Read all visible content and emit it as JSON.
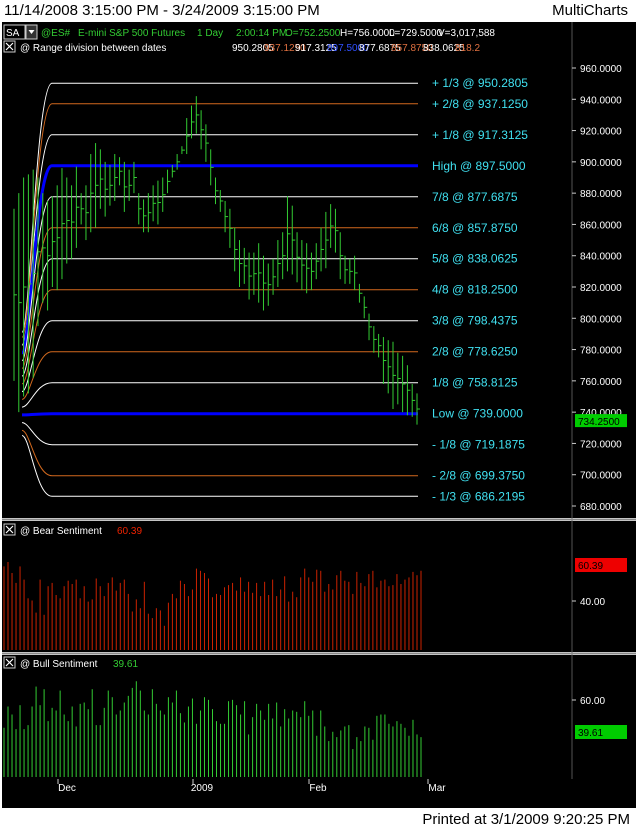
{
  "window": {
    "date_range": "11/14/2008 3:15:00 PM - 3/24/2009 3:15:00 PM",
    "app_name": "MultiCharts",
    "printed": "Printed at 3/1/2009 9:20:25 PM"
  },
  "colors": {
    "background": "#000000",
    "price_bar": "#33cc33",
    "white_level": "#ffffff",
    "orange_level": "#d2691e",
    "blue_level": "#0000ff",
    "level_label": "#40e0f0",
    "bear": "#cc2200",
    "bull": "#33cc33",
    "last_price_bg": "#00cc00",
    "bear_value_bg": "#ee0000"
  },
  "header": {
    "sa_button": "SA",
    "symbol": "@ES#",
    "description": "E-mini S&P 500 Futures",
    "interval": "1 Day",
    "time": "2:00:14 PM",
    "open": "O=752.2500",
    "high": "H=756.0000",
    "low": "L=729.5000",
    "volume": "V=3,017,588"
  },
  "study_header": {
    "name": "@ Range division between dates",
    "values": [
      {
        "text": "950.2805",
        "color": "#ffffff"
      },
      {
        "text": "937.1250",
        "color": "#e07040"
      },
      {
        "text": "917.3125",
        "color": "#ffffff"
      },
      {
        "text": "897.5000",
        "color": "#3050ff"
      },
      {
        "text": "877.6875",
        "color": "#ffffff"
      },
      {
        "text": "857.8750",
        "color": "#e07040"
      },
      {
        "text": "838.0625",
        "color": "#ffffff"
      },
      {
        "text": "818.2",
        "color": "#e07040"
      }
    ]
  },
  "bear_panel": {
    "name": "@ Bear Sentiment",
    "value": "60.39",
    "tick": "40.00"
  },
  "bull_panel": {
    "name": "@ Bull Sentiment",
    "value": "39.61",
    "tick": "60.00"
  },
  "chart_data": [
    {
      "type": "ohlc",
      "title": "@ES# E-mini S&P 500 Futures 1 Day",
      "x_labels": [
        "Dec",
        "2009",
        "Feb",
        "Mar"
      ],
      "ylim": [
        672,
        966
      ],
      "y_ticks": [
        "960.0000",
        "940.0000",
        "920.0000",
        "900.0000",
        "880.0000",
        "860.0000",
        "840.0000",
        "820.0000",
        "800.0000",
        "780.0000",
        "760.0000",
        "740.0000",
        "720.0000",
        "700.0000",
        "680.0000"
      ],
      "last_price": "734.2500",
      "levels": [
        {
          "label": "+ 1/3 @ 950.2805",
          "value": 950.2805,
          "color": "white"
        },
        {
          "label": "+ 2/8 @ 937.1250",
          "value": 937.125,
          "color": "orange"
        },
        {
          "label": "+ 1/8 @ 917.3125",
          "value": 917.3125,
          "color": "white"
        },
        {
          "label": "High @ 897.5000",
          "value": 897.5,
          "color": "blue"
        },
        {
          "label": "7/8 @ 877.6875",
          "value": 877.6875,
          "color": "white"
        },
        {
          "label": "6/8 @ 857.8750",
          "value": 857.875,
          "color": "orange"
        },
        {
          "label": "5/8 @ 838.0625",
          "value": 838.0625,
          "color": "white"
        },
        {
          "label": "4/8 @ 818.2500",
          "value": 818.25,
          "color": "orange"
        },
        {
          "label": "3/8 @ 798.4375",
          "value": 798.4375,
          "color": "white"
        },
        {
          "label": "2/8 @ 778.6250",
          "value": 778.625,
          "color": "orange"
        },
        {
          "label": "1/8 @ 758.8125",
          "value": 758.8125,
          "color": "white"
        },
        {
          "label": "Low @ 739.0000",
          "value": 739.0,
          "color": "blue"
        },
        {
          "label": "- 1/8 @ 719.1875",
          "value": 719.1875,
          "color": "white"
        },
        {
          "label": "- 2/8 @ 699.3750",
          "value": 699.375,
          "color": "orange"
        },
        {
          "label": "- 1/3 @ 686.2195",
          "value": 686.2195,
          "color": "white"
        }
      ],
      "bars": [
        [
          870,
          760
        ],
        [
          880,
          740
        ],
        [
          890,
          750
        ],
        [
          892,
          752
        ],
        [
          895,
          762
        ],
        [
          890,
          795
        ],
        [
          880,
          810
        ],
        [
          875,
          805
        ],
        [
          878,
          820
        ],
        [
          885,
          818
        ],
        [
          896,
          825
        ],
        [
          890,
          835
        ],
        [
          885,
          838
        ],
        [
          897,
          845
        ],
        [
          880,
          860
        ],
        [
          885,
          850
        ],
        [
          905,
          855
        ],
        [
          912,
          858
        ],
        [
          908,
          870
        ],
        [
          900,
          865
        ],
        [
          898,
          872
        ],
        [
          905,
          875
        ],
        [
          903,
          885
        ],
        [
          900,
          868
        ],
        [
          895,
          875
        ],
        [
          900,
          880
        ],
        [
          880,
          860
        ],
        [
          876,
          855
        ],
        [
          880,
          855
        ],
        [
          885,
          862
        ],
        [
          888,
          860
        ],
        [
          890,
          868
        ],
        [
          895,
          880
        ],
        [
          898,
          890
        ],
        [
          905,
          895
        ],
        [
          910,
          905
        ],
        [
          928,
          905
        ],
        [
          936,
          915
        ],
        [
          942,
          918
        ],
        [
          933,
          908
        ],
        [
          924,
          900
        ],
        [
          908,
          885
        ],
        [
          890,
          873
        ],
        [
          882,
          868
        ],
        [
          875,
          855
        ],
        [
          870,
          845
        ],
        [
          858,
          830
        ],
        [
          850,
          820
        ],
        [
          845,
          822
        ],
        [
          842,
          812
        ],
        [
          842,
          815
        ],
        [
          848,
          810
        ],
        [
          840,
          805
        ],
        [
          835,
          808
        ],
        [
          838,
          815
        ],
        [
          850,
          820
        ],
        [
          855,
          825
        ],
        [
          878,
          830
        ],
        [
          872,
          828
        ],
        [
          855,
          823
        ],
        [
          850,
          818
        ],
        [
          848,
          816
        ],
        [
          842,
          818
        ],
        [
          848,
          825
        ],
        [
          858,
          830
        ],
        [
          868,
          832
        ],
        [
          873,
          845
        ],
        [
          870,
          842
        ],
        [
          855,
          825
        ],
        [
          840,
          822
        ],
        [
          838,
          822
        ],
        [
          840,
          818
        ],
        [
          822,
          810
        ],
        [
          814,
          800
        ],
        [
          803,
          786
        ],
        [
          795,
          778
        ],
        [
          790,
          775
        ],
        [
          788,
          758
        ],
        [
          786,
          752
        ],
        [
          785,
          742
        ],
        [
          778,
          745
        ],
        [
          776,
          740
        ],
        [
          770,
          738
        ],
        [
          758,
          737
        ],
        [
          752,
          732
        ]
      ]
    },
    {
      "type": "bar",
      "title": "@ Bear Sentiment",
      "ylim": [
        0,
        100
      ],
      "values": [
        76,
        80,
        70,
        61,
        76,
        64,
        47,
        45,
        34,
        64,
        32,
        58,
        61,
        50,
        47,
        58,
        63,
        60,
        64,
        47,
        58,
        44,
        46,
        65,
        58,
        49,
        61,
        66,
        54,
        61,
        64,
        51,
        35,
        46,
        38,
        62,
        33,
        29,
        38,
        36,
        22,
        43,
        51,
        47,
        63,
        60,
        49,
        55,
        74,
        72,
        70,
        65,
        48,
        51,
        50,
        57,
        59,
        61,
        54,
        66,
        53,
        62,
        52,
        61,
        49,
        62,
        50,
        64,
        49,
        55,
        67,
        44,
        53,
        48,
        66,
        74,
        66,
        62,
        73,
        72,
        53,
        60,
        55,
        68,
        72,
        63,
        62,
        51,
        71,
        61,
        58,
        69,
        72,
        57,
        63,
        64,
        58,
        59,
        69,
        60,
        64,
        66,
        71,
        68,
        72
      ]
    },
    {
      "type": "bar",
      "title": "@ Bull Sentiment",
      "ylim": [
        0,
        100
      ],
      "values": [
        37,
        53,
        47,
        36,
        54,
        36,
        39,
        53,
        68,
        54,
        66,
        42,
        52,
        50,
        65,
        47,
        42,
        53,
        38,
        55,
        56,
        51,
        66,
        39,
        39,
        52,
        65,
        60,
        47,
        50,
        56,
        61,
        67,
        72,
        65,
        50,
        47,
        66,
        55,
        50,
        47,
        60,
        56,
        65,
        48,
        41,
        53,
        59,
        40,
        50,
        60,
        58,
        51,
        42,
        40,
        40,
        57,
        58,
        54,
        47,
        57,
        32,
        45,
        55,
        50,
        43,
        55,
        44,
        56,
        38,
        51,
        44,
        50,
        49,
        45,
        57,
        46,
        50,
        31,
        50,
        38,
        27,
        34,
        30,
        35,
        38,
        39,
        21,
        30,
        27,
        38,
        37,
        28,
        46,
        47,
        47,
        40,
        38,
        42,
        40,
        37,
        31,
        43,
        32,
        30
      ]
    }
  ]
}
